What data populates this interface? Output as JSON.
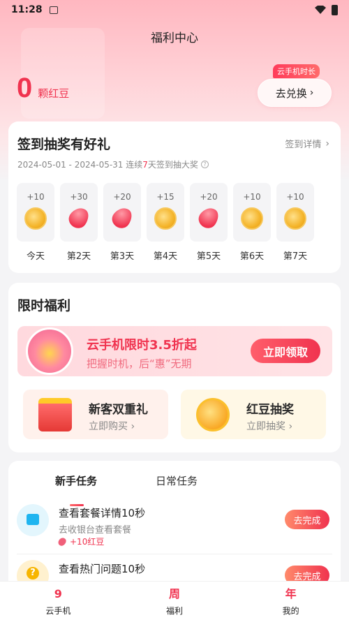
{
  "status_bar": {
    "time": "11:28"
  },
  "header": {
    "title": "福利中心"
  },
  "points": {
    "value": "0",
    "unit": "颗红豆"
  },
  "exchange": {
    "badge": "云手机时长",
    "button_label": "去兑换"
  },
  "checkin": {
    "title": "签到抽奖有好礼",
    "detail_label": "签到详情",
    "date_range": "2024-05-01 - 2024-05-31",
    "streak_prefix": "连续",
    "streak_days": "7",
    "streak_suffix": "天签到抽大奖",
    "days": [
      {
        "points": "+10",
        "reward": "coin-icon",
        "label": "今天"
      },
      {
        "points": "+30",
        "reward": "bean-icon",
        "label": "第2天"
      },
      {
        "points": "+20",
        "reward": "bean-icon",
        "label": "第3天"
      },
      {
        "points": "+15",
        "reward": "coin-icon",
        "label": "第4天"
      },
      {
        "points": "+20",
        "reward": "bean-icon",
        "label": "第5天"
      },
      {
        "points": "+10",
        "reward": "coin-icon",
        "label": "第6天"
      },
      {
        "points": "+10",
        "reward": "coin-icon",
        "label": "第7天"
      }
    ]
  },
  "limited": {
    "title": "限时福利",
    "banner": {
      "headline": "云手机限时3.5折起",
      "tagline": "把握时机，后“惠”无期",
      "button_label": "立即领取"
    },
    "promos": [
      {
        "title": "新客双重礼",
        "subtitle": "立即购买"
      },
      {
        "title": "红豆抽奖",
        "subtitle": "立即抽奖"
      }
    ]
  },
  "tasks": {
    "tabs": [
      "新手任务",
      "日常任务"
    ],
    "active_tab": "新手任务",
    "items": [
      {
        "title": "查看套餐详情10秒",
        "desc": "去收银台查看套餐",
        "reward": "+10红豆",
        "button_label": "去完成"
      },
      {
        "title": "查看热门问题10秒",
        "desc": "",
        "reward": "",
        "button_label": "去完成"
      }
    ]
  },
  "bottom_nav": {
    "items": [
      {
        "label": "云手机",
        "icon_glyph": "9"
      },
      {
        "label": "福利",
        "icon_glyph": "周"
      },
      {
        "label": "我的",
        "icon_glyph": "年"
      }
    ]
  },
  "colors": {
    "accent": "#f0334f",
    "background": "#f4f4f6"
  }
}
